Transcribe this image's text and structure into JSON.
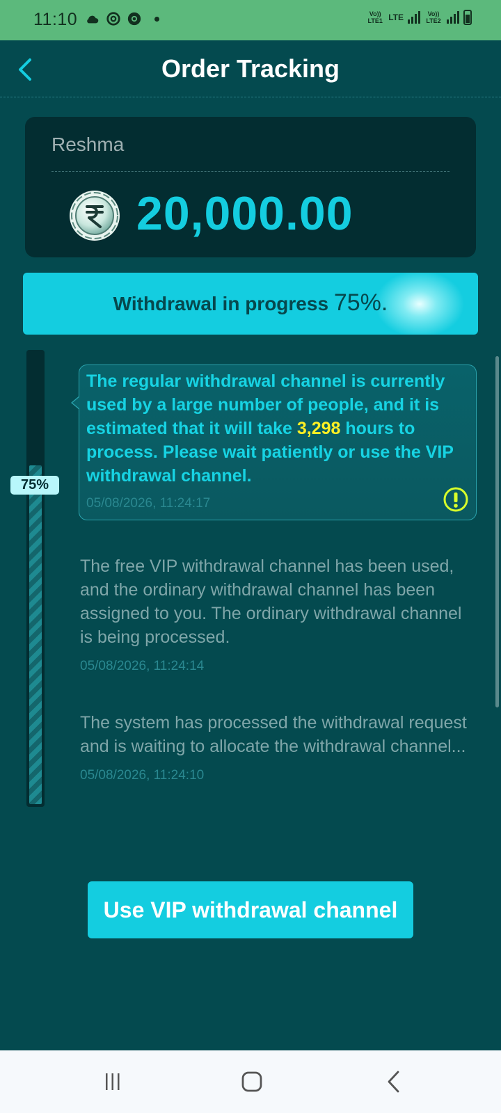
{
  "status_bar": {
    "time": "11:10",
    "net1": "Vo)) LTE1",
    "net_type": "LTE",
    "net2": "Vo)) LTE2",
    "icons": [
      "cloud-icon",
      "threads-icon",
      "chrome-icon",
      "notification-dot"
    ]
  },
  "header": {
    "title": "Order Tracking",
    "back_icon": "chevron-left-icon"
  },
  "balance": {
    "user_name": "Reshma",
    "currency_icon": "rupee-coin-icon",
    "amount": "20,000.00"
  },
  "progress": {
    "label": "Withdrawal in progress",
    "percent_text": "75%.",
    "badge": "75%",
    "level": 0.75
  },
  "timeline": {
    "current": {
      "text_before": "The regular withdrawal channel is currently used by a large number of people, and it is estimated that it will take",
      "highlight": "3,298",
      "text_after": "hours to process. Please wait patiently or use the VIP withdrawal channel.",
      "time": "05/08/2026, 11:24:17",
      "alert_icon": "exclamation-circle-icon"
    },
    "entries": [
      {
        "text": "The free VIP withdrawal channel has been used, and the ordinary withdrawal channel has been assigned to you. The ordinary withdrawal channel is being processed.",
        "time": "05/08/2026, 11:24:14"
      },
      {
        "text": "The system has processed the withdrawal request and is waiting to allocate the withdrawal channel...",
        "time": "05/08/2026, 11:24:10"
      }
    ]
  },
  "actions": {
    "vip_button": "Use VIP withdrawal channel"
  },
  "nav": {
    "recents_icon": "recents-icon",
    "home_icon": "home-icon",
    "back_icon": "back-icon"
  },
  "colors": {
    "background": "#044a4f",
    "accent": "#14cde0",
    "highlight": "#fff024",
    "status_bar": "#5cb97c"
  }
}
